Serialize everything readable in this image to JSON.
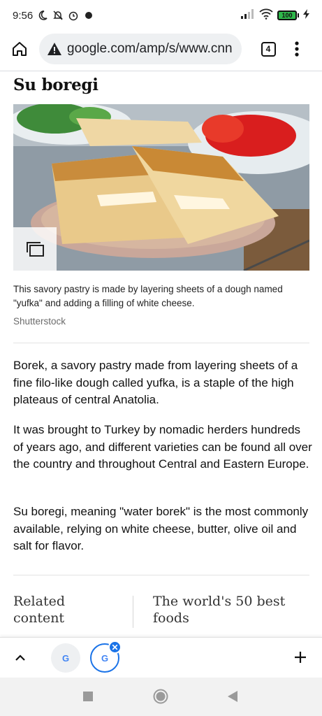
{
  "status_bar": {
    "time": "9:56",
    "battery": "100",
    "icons": [
      "moon-icon",
      "mute-notifications-icon",
      "alarm-icon",
      "app-notification-icon",
      "signal-icon",
      "wifi-icon",
      "battery-icon",
      "charging-icon"
    ]
  },
  "browser": {
    "url": "google.com/amp/s/www.cnn",
    "tab_count": "4",
    "icons": [
      "home-icon",
      "warning-icon",
      "menu-dots-icon"
    ]
  },
  "article": {
    "title": "Su boregi",
    "image_caption": "This savory pastry is made by layering sheets of a dough named \"yufka\" and adding a filling of white cheese.",
    "image_credit": "Shutterstock",
    "paragraphs": [
      "Borek, a savory pastry made from layering sheets of a fine filo-like dough called yufka, is a staple of the high plateaus of central Anatolia.",
      "It was brought to Turkey by nomadic herders hundreds of years ago, and different varieties can be found all over the country and throughout Central and Eastern Europe.",
      "Su boregi, meaning \"water borek\" is the most commonly available, relying on white cheese, butter, olive oil and salt for flavor."
    ]
  },
  "related": {
    "label": "Related content",
    "link": "The world's 50 best foods"
  },
  "tab_strip": {
    "tab1_label": "G",
    "tab2_label": "G",
    "close_label": "✕"
  },
  "colors": {
    "accent": "#1a73e8",
    "url_bar_bg": "#eef0f2",
    "battery": "#2fb84b"
  }
}
